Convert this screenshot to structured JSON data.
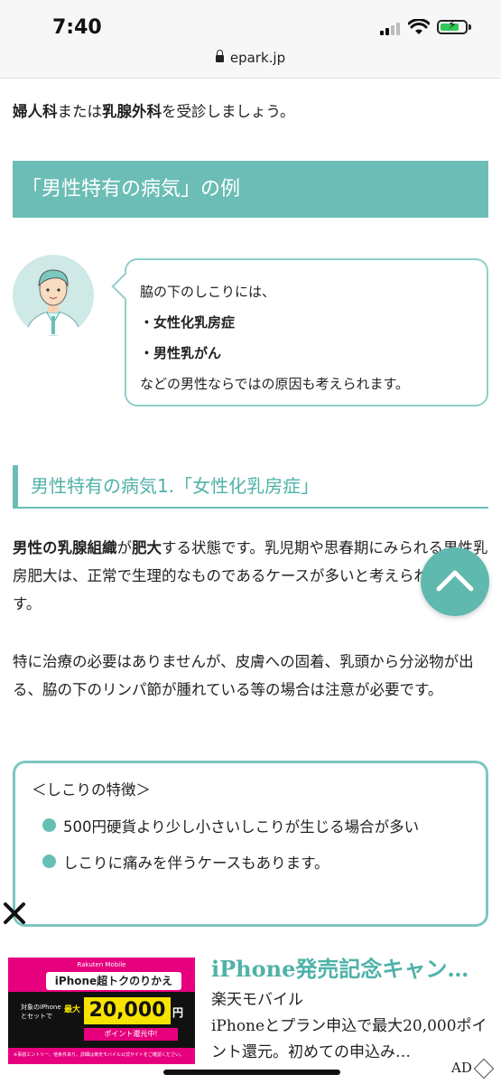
{
  "status": {
    "time": "7:40",
    "url": "epark.jp"
  },
  "intro": {
    "part1": "婦人科",
    "part2": "または",
    "part3": "乳腺外科",
    "part4": "を受診しましょう。"
  },
  "section_heading": "「男性特有の病気」の例",
  "bubble": {
    "line1": "脇の下のしこりには、",
    "item1": "・女性化乳房症",
    "item2": "・男性乳がん",
    "line4": "などの男性ならではの原因も考えられます。"
  },
  "subheading": "男性特有の病気1.「女性化乳房症」",
  "para1": {
    "b1": "男性の乳腺組織",
    "t1": "が",
    "b2": "肥大",
    "t2": "する状態です。乳児期や思春期にみられる男性乳房肥大は、正常で生理的なものであるケースが多いと考えられています。"
  },
  "para2": "特に治療の必要はありませんが、皮膚への固着、乳頭から分泌物が出る、脇の下のリンパ節が腫れている等の場合は注意が必要です。",
  "feature_box": {
    "title": "＜しこりの特徴＞",
    "items": [
      "500円硬貨より少し小さいしこりが生じる場合が多い",
      "しこりに痛みを伴うケースもあります。"
    ]
  },
  "ad": {
    "title": "iPhone発売記念キャン…",
    "advertiser": "楽天モバイル",
    "description": "iPhoneとプラン申込で最大20,000ポイント還元。初めての申込み…",
    "badge": "AD",
    "image": {
      "brand": "Rakuten Mobile",
      "banner": "iPhone超トクのりかえ",
      "target": "対象のiPhone\nとセットで",
      "max": "最大",
      "amount": "20,000",
      "unit": "円",
      "points": "ポイント還元中!",
      "fine": "※事前エントリー、他条件あり。詳細は楽天モバイル公式サイトをご確認ください。"
    }
  },
  "colors": {
    "accent": "#6bbdb5",
    "accent_text": "#4fb2a8"
  },
  "icons": [
    "lock-icon",
    "signal-icon",
    "wifi-icon",
    "battery-icon",
    "scroll-top-icon",
    "close-icon",
    "ad-choices-icon"
  ]
}
